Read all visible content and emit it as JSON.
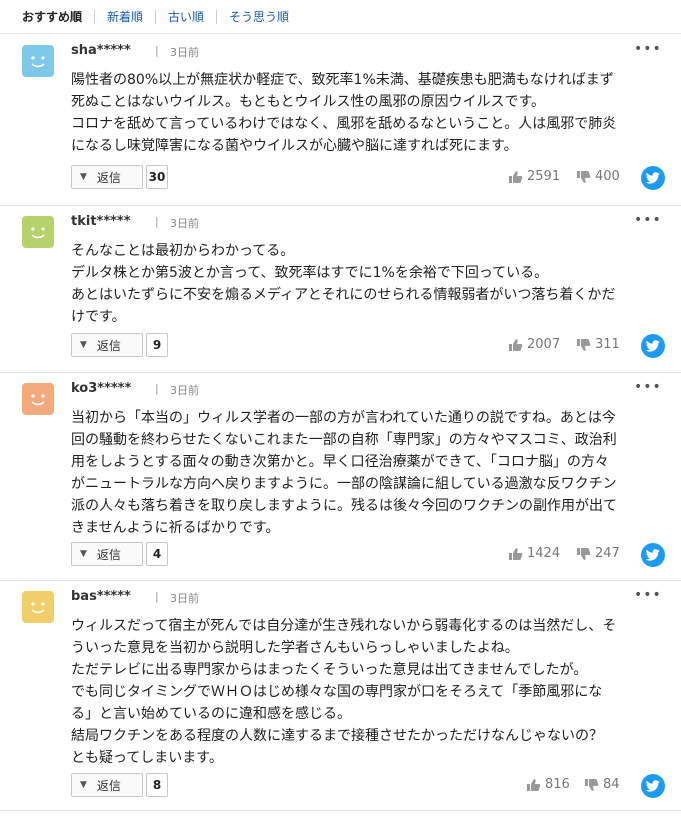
{
  "tabs": [
    "おすすめ順",
    "新着順",
    "古い順",
    "そう思う順"
  ],
  "reply_label": "返信",
  "comments": [
    {
      "user": "sha*****",
      "time": "3日前",
      "avatar_color": "#7ec8e8",
      "lines": [
        "陽性者の80%以上が無症状か軽症で、致死率1%未満、基礎疾患も肥満もなければまず",
        "死ぬことはないウイルス。もともとウイルス性の風邪の原因ウイルスです。",
        "コロナを舐めて言っているわけではなく、風邪を舐めるなということ。人は風邪で肺炎",
        "になるし味覚障害になる菌やウイルスが心臓や脳に達すれば死にます。"
      ],
      "replies": "30",
      "likes": "2591",
      "dislikes": "400"
    },
    {
      "user": "tkit*****",
      "time": "3日前",
      "avatar_color": "#b5d36a",
      "lines": [
        "そんなことは最初からわかってる。",
        "デルタ株とか第5波とか言って、致死率はすでに1%を余裕で下回っている。",
        "あとはいたずらに不安を煽るメディアとそれにのせられる情報弱者がいつ落ち着くかだ",
        "けです。"
      ],
      "replies": "9",
      "likes": "2007",
      "dislikes": "311"
    },
    {
      "user": "ko3*****",
      "time": "3日前",
      "avatar_color": "#f2a97c",
      "lines": [
        "当初から「本当の」ウィルス学者の一部の方が言われていた通りの説ですね。あとは今",
        "回の騒動を終わらせたくないこれまた一部の自称「専門家」の方々やマスコミ、政治利",
        "用をしようとする面々の動き次第かと。早く口径治療薬ができて、「コロナ脳」の方々",
        "がニュートラルな方向へ戻りますように。一部の陰謀論に組している過激な反ワクチン",
        "派の人々も落ち着きを取り戻しますように。残るは後々今回のワクチンの副作用が出て",
        "きませんように祈るばかりです。"
      ],
      "replies": "4",
      "likes": "1424",
      "dislikes": "247"
    },
    {
      "user": "bas*****",
      "time": "3日前",
      "avatar_color": "#f0cf6a",
      "lines": [
        "ウィルスだって宿主が死んでは自分達が生き残れないから弱毒化するのは当然だし、そ",
        "ういった意見を当初から説明した学者さんもいらっしゃいましたよね。",
        "ただテレビに出る専門家からはまったくそういった意見は出てきませんでしたが。",
        "でも同じタイミングでＷＨＯはじめ様々な国の専門家が口をそろえて「季節風邪にな",
        "る」と言い始めているのに違和感を感じる。",
        "結局ワクチンをある程度の人数に達するまで接種させたかっただけなんじゃないの？",
        "とも疑ってしまいます。"
      ],
      "replies": "8",
      "likes": "816",
      "dislikes": "84"
    }
  ]
}
